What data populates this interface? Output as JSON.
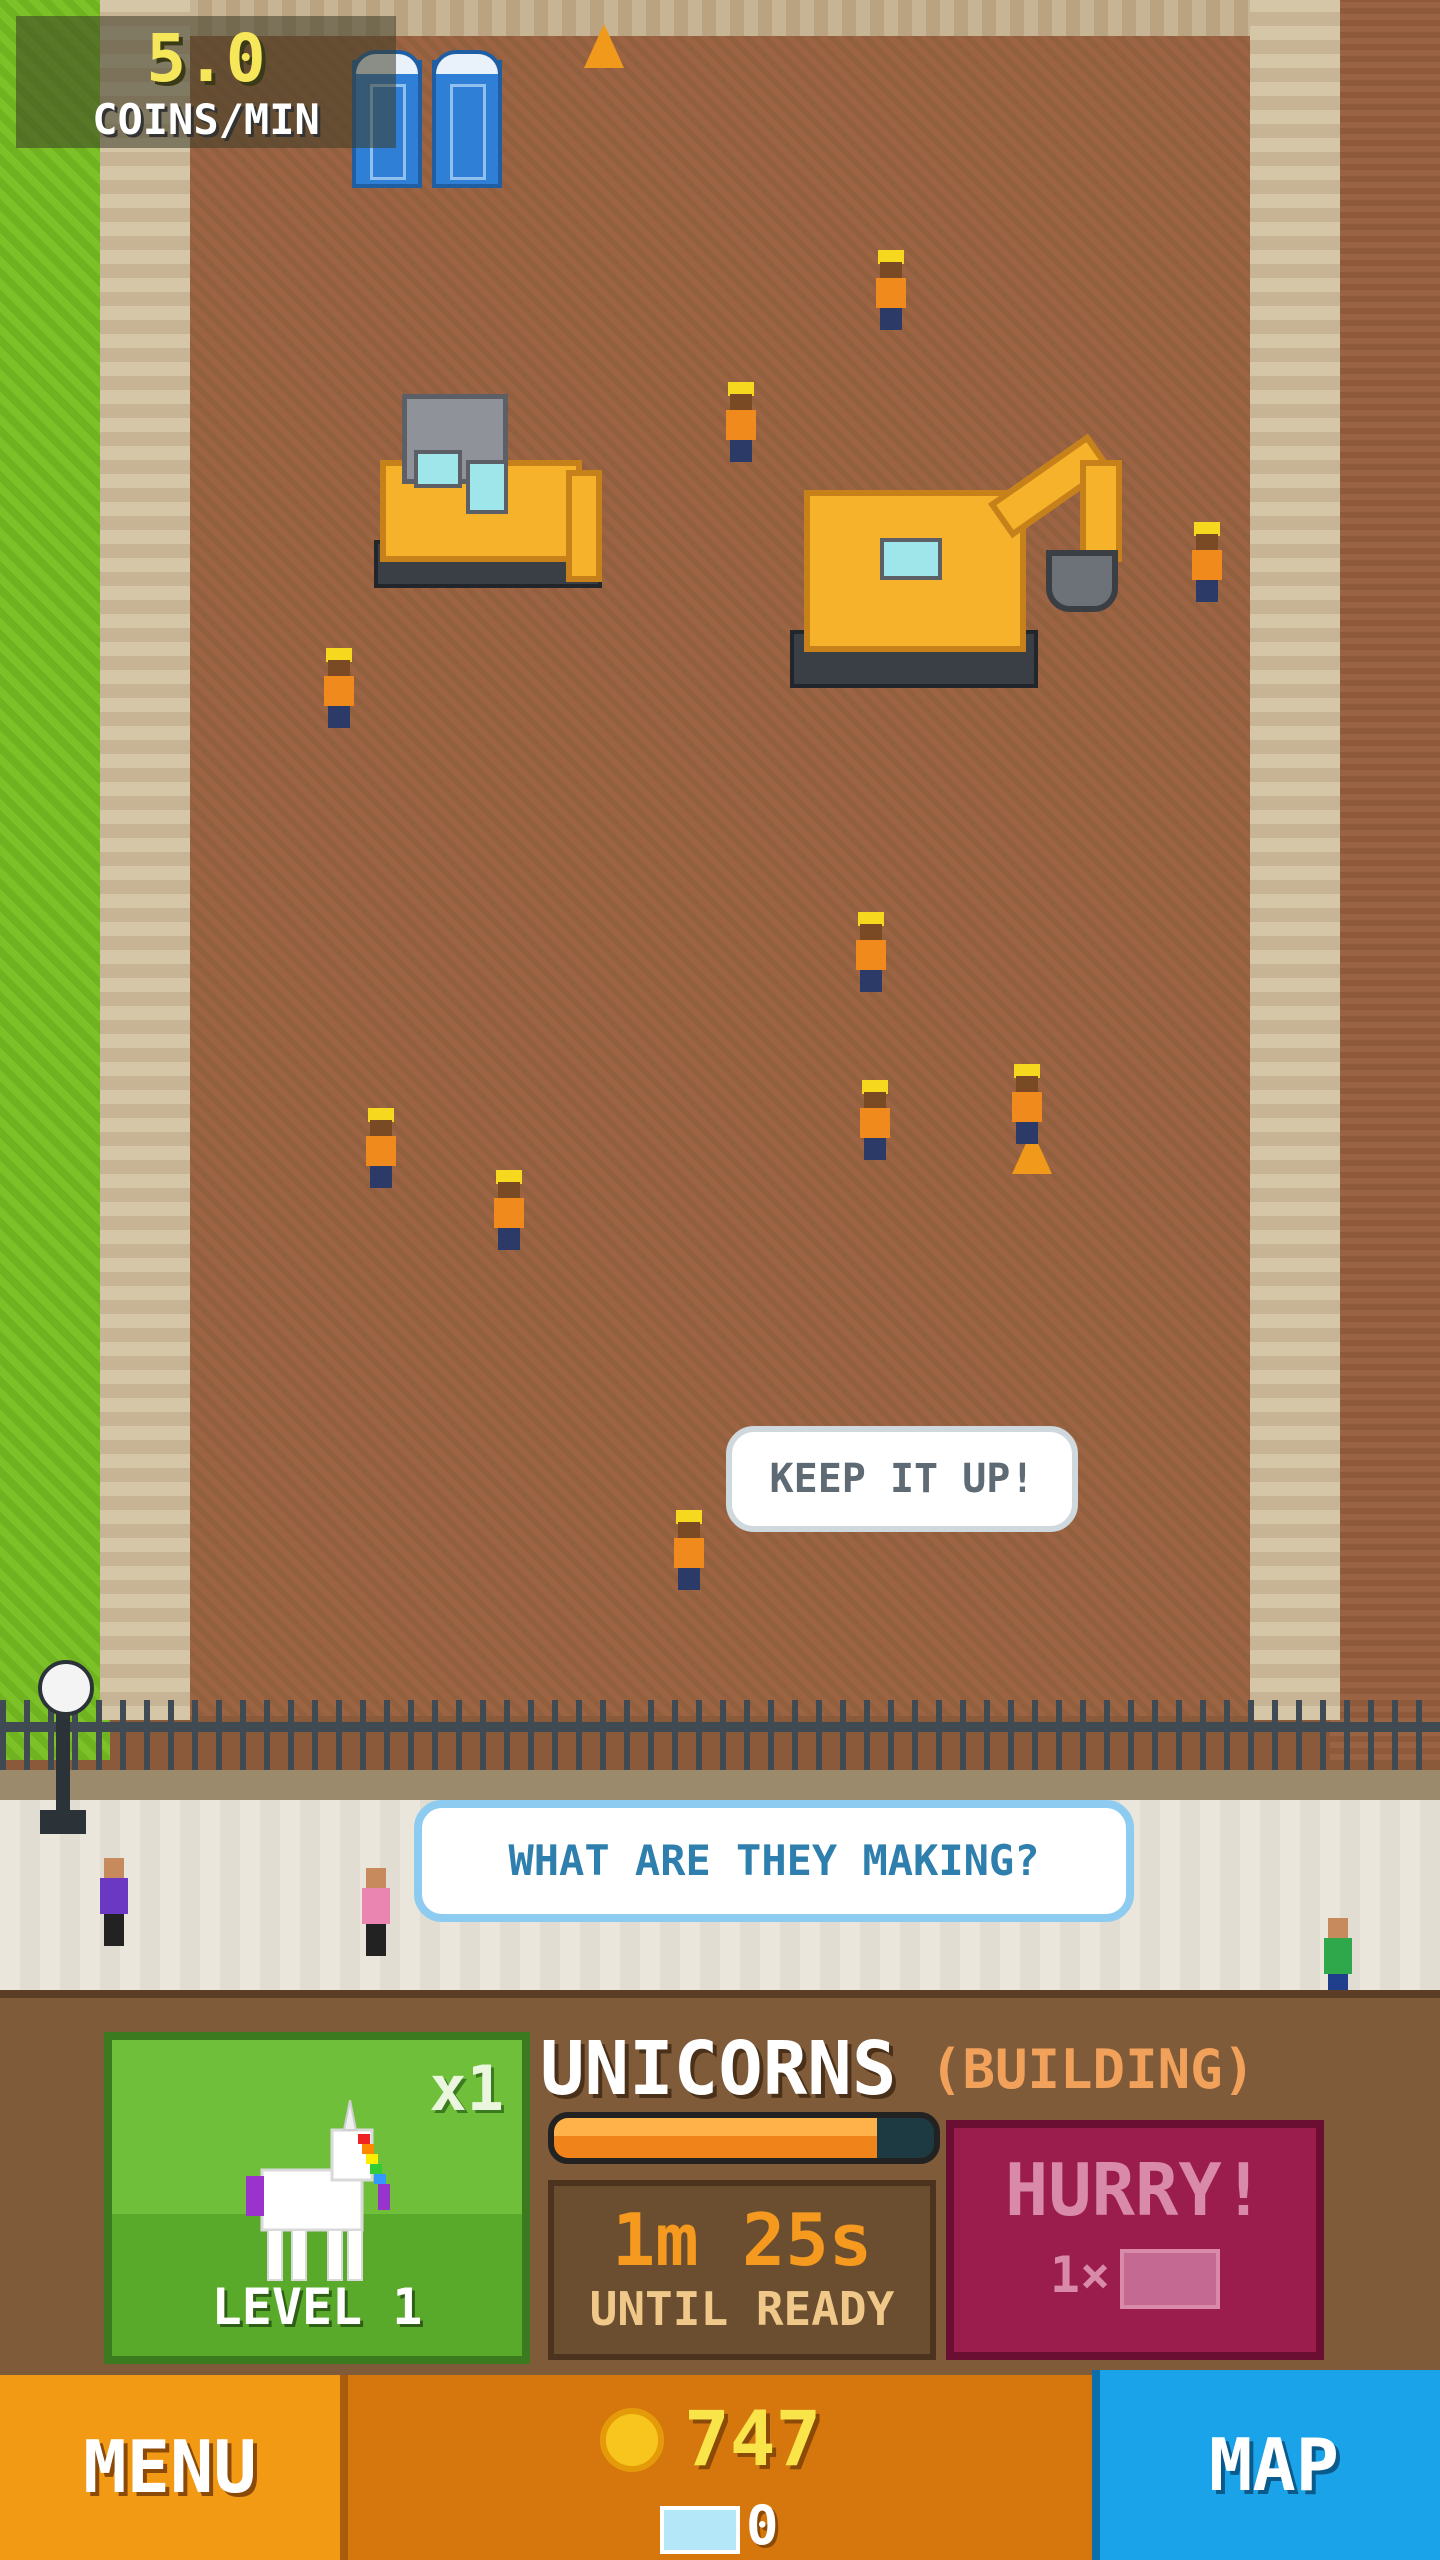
{
  "hud": {
    "coins_rate_value": "5.0",
    "coins_rate_unit": "COINS/MIN"
  },
  "speech": {
    "worker_bubble": "KEEP IT UP!",
    "pedestrian_bubble": "WHAT ARE THEY MAKING?"
  },
  "panel": {
    "unit_multiplier": "x1",
    "unit_level": "LEVEL 1",
    "building_name": "UNICORNS",
    "building_status": "(BUILDING)",
    "progress": 0.85,
    "timer_value": "1m 25s",
    "timer_label": "UNTIL READY",
    "hurry_label": "HURRY!",
    "hurry_cost": "1×"
  },
  "bottom": {
    "menu_label": "MENU",
    "map_label": "MAP",
    "coins": "747",
    "gems": "0"
  },
  "colors": {
    "menu": "#f39a14",
    "map": "#1aa3e8",
    "hurry": "#9a1d4e",
    "unit_card": "#6fbf3a"
  }
}
